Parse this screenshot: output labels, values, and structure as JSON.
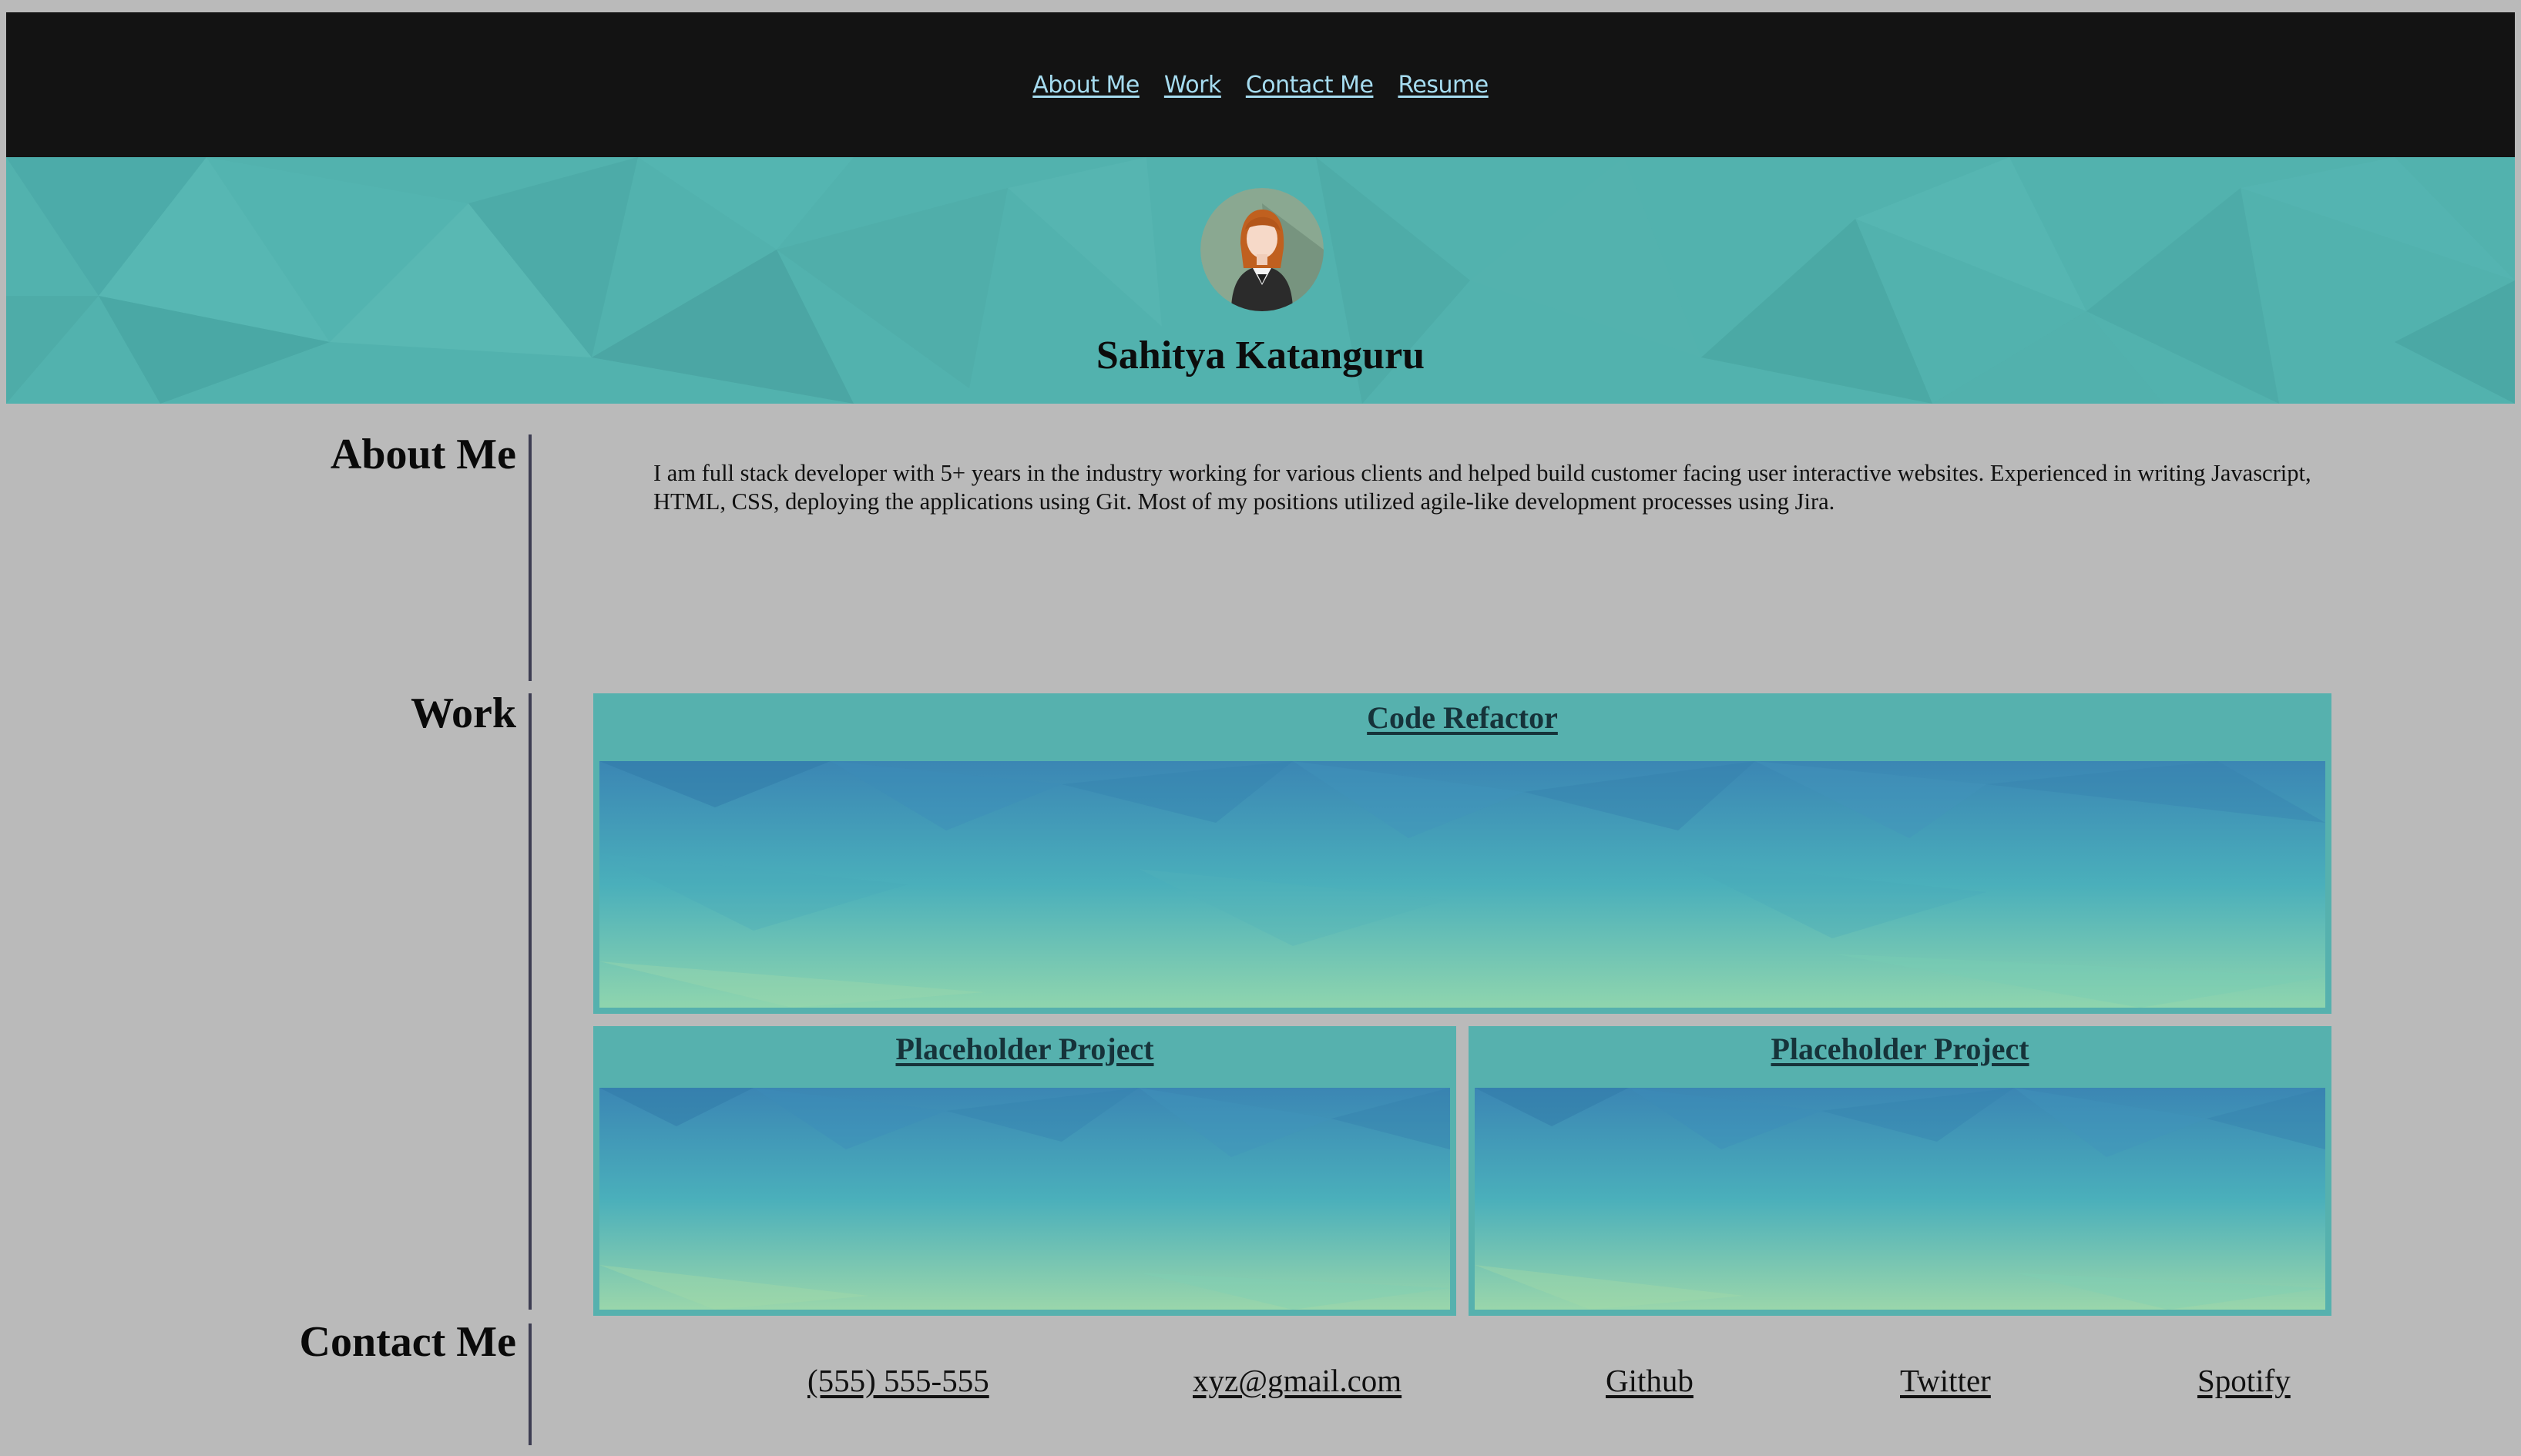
{
  "nav": {
    "items": [
      {
        "label": "About Me"
      },
      {
        "label": "Work"
      },
      {
        "label": "Contact Me"
      },
      {
        "label": "Resume"
      }
    ]
  },
  "hero": {
    "name": "Sahitya Katanguru",
    "avatar_icon": "person-avatar-icon"
  },
  "about": {
    "title": "About Me",
    "text": "I am full stack developer with 5+ years in the industry working for various clients and helped build customer facing user interactive websites. Experienced in writing Javascript, HTML, CSS, deploying the applications using Git. Most of my positions utilized agile-like development processes using Jira."
  },
  "work": {
    "title": "Work",
    "projects": [
      {
        "title": "Code Refactor"
      },
      {
        "title": "Placeholder Project"
      },
      {
        "title": "Placeholder Project"
      }
    ]
  },
  "contact": {
    "title": "Contact Me",
    "links": [
      {
        "label": "(555) 555-555"
      },
      {
        "label": "xyz@gmail.com"
      },
      {
        "label": "Github"
      },
      {
        "label": "Twitter"
      },
      {
        "label": "Spotify"
      }
    ]
  },
  "colors": {
    "background": "#bababa",
    "nav_bg": "#131313",
    "nav_link": "#a6dcf0",
    "hero_teal": "#52b2ae",
    "card_teal": "#56b1ae",
    "divider": "#3d3d52"
  }
}
